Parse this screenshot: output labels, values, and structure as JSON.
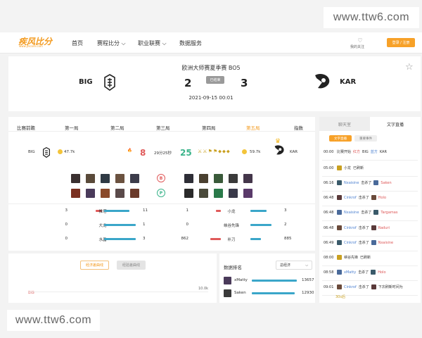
{
  "watermark": "www.ttw6.com",
  "nav": {
    "logo": "疾风比分",
    "logo_sub": "www.jfscore.com",
    "items": [
      "首页",
      "赛程比分",
      "职业联赛",
      "数据服务"
    ],
    "my_follow": "我的关注",
    "login": "登录 / 注册"
  },
  "match": {
    "title": "欧洲大师赛夏季赛 BO5",
    "status": "已结束",
    "team_left": "BIG",
    "team_right": "KAR",
    "score_left": "2",
    "score_right": "3",
    "datetime": "2021-09-15 00:01"
  },
  "tabs": [
    "比赛前瞻",
    "第一局",
    "第二局",
    "第三局",
    "第四局",
    "第五局",
    "指数"
  ],
  "active_tab": "第五局",
  "game": {
    "left_team": "BIG",
    "left_gold": "47.7k",
    "left_kills": "8",
    "duration": "29分25秒",
    "right_kills": "25",
    "right_gold": "59.7k",
    "right_team": "KAR",
    "ban_left": "B",
    "pick_left": "P",
    "stats": [
      {
        "left": "3",
        "label": "推塔",
        "right": "11",
        "left_frac": 0.21,
        "right_frac": 0.79
      },
      {
        "left": "0",
        "label": "大龙",
        "right": "1",
        "left_frac": 0.0,
        "right_frac": 1.0
      },
      {
        "left": "0",
        "label": "水晶",
        "right": "3",
        "left_frac": 0.0,
        "right_frac": 1.0
      }
    ],
    "stats_right": [
      {
        "left": "1",
        "label": "小龙",
        "right": "3",
        "left_frac": 0.25,
        "right_frac": 0.75
      },
      {
        "left": "0",
        "label": "峡谷先锋",
        "right": "2",
        "left_frac": 0.0,
        "right_frac": 1.0
      },
      {
        "left": "862",
        "label": "补刀",
        "right": "885",
        "left_frac": 0.49,
        "right_frac": 0.51
      }
    ]
  },
  "bottom": {
    "btn1": "经济差曲线",
    "btn2": "经验差曲线",
    "chart_team": "BIG",
    "chart_tick": "10.0k",
    "rank_title": "数据排名",
    "rank_select": "总经济",
    "rank": [
      {
        "name": "xMatty",
        "value": "13657",
        "frac": 1.0
      },
      {
        "name": "Saken",
        "value": "12930",
        "frac": 0.95
      }
    ]
  },
  "side": {
    "tab1": "聊天室",
    "tab2": "文字直播",
    "pill1": "文字直播",
    "pill2": "重要事件",
    "events": [
      {
        "time": "00:00",
        "parts": [
          "比赛开始",
          "红方",
          "BIG",
          "蓝方",
          "KAR"
        ]
      },
      {
        "time": "05:00",
        "parts": [
          "小龙",
          "已刷新"
        ]
      },
      {
        "time": "06:16",
        "parts": [
          "Nxaisine",
          "击杀了",
          "Saken"
        ]
      },
      {
        "time": "06:48",
        "parts": [
          "Cinkrof",
          "击杀了",
          "Holo"
        ]
      },
      {
        "time": "06:48",
        "parts": [
          "Nxaisine",
          "击杀了",
          "Targamas"
        ]
      },
      {
        "time": "06:48",
        "parts": [
          "Cinkrof",
          "击杀了",
          "Raduri"
        ]
      },
      {
        "time": "06:49",
        "parts": [
          "Cinkrof",
          "击杀了",
          "Nxaisine"
        ]
      },
      {
        "time": "08:00",
        "parts": [
          "峡谷先锋",
          "已刷新"
        ]
      },
      {
        "time": "08:58",
        "parts": [
          "xMatty",
          "击杀了",
          "Holo"
        ]
      },
      {
        "time": "09:01",
        "parts": [
          "Cinkrof",
          "击杀了",
          "下次刷新时间为"
        ]
      }
    ],
    "last_line": "30s后"
  },
  "colors": {
    "accent": "#f39a1e",
    "blue_bar": "#3aa6c9",
    "red_bar": "#e05a5a"
  }
}
